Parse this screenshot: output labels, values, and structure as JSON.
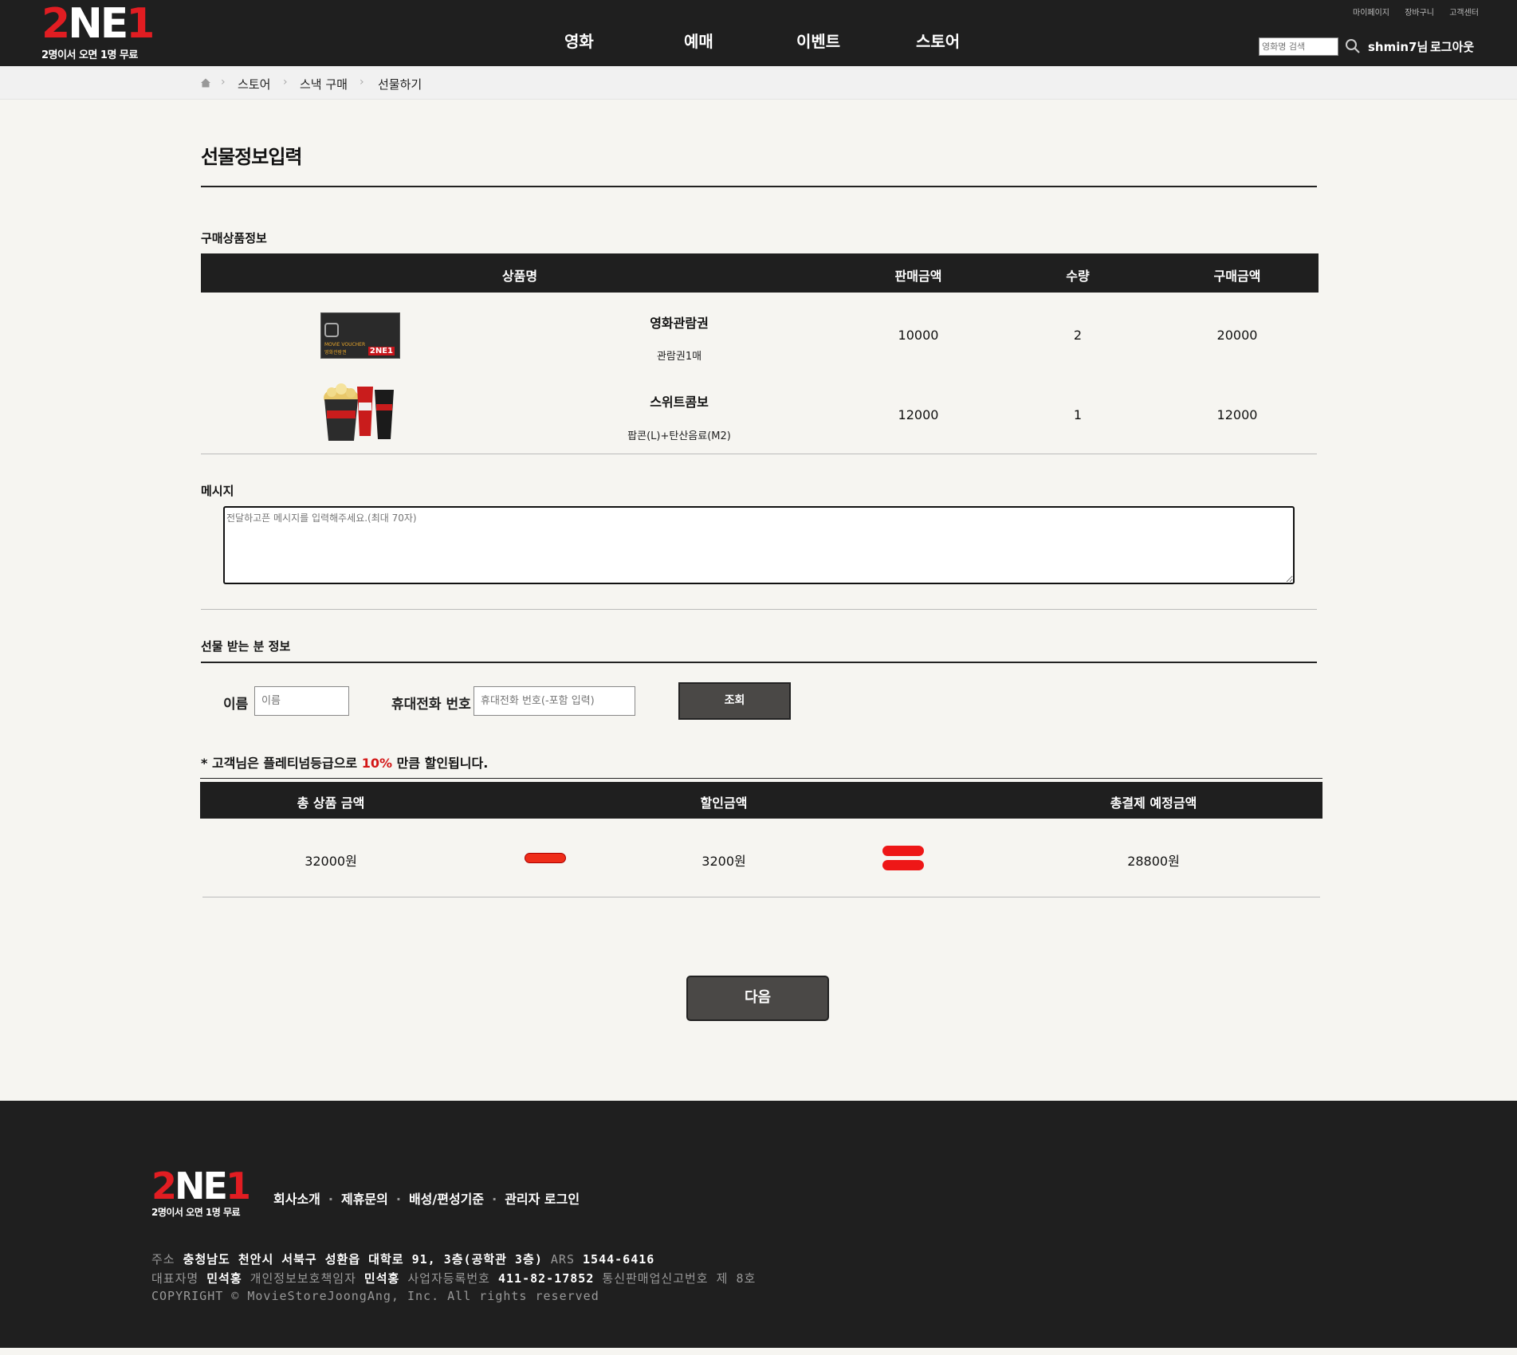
{
  "header": {
    "logo_mark": "2NE1",
    "logo_tagline": "2명이서 오면 1명 무료",
    "nav": [
      "영화",
      "예매",
      "이벤트",
      "스토어"
    ],
    "util_links": [
      "마이페이지",
      "장바구니",
      "고객센터"
    ],
    "search_placeholder": "영화명 검색",
    "user_name": "shmin7님",
    "logout": "로그아웃"
  },
  "breadcrumb": [
    "스토어",
    "스낵 구매",
    "선물하기"
  ],
  "page_title": "선물정보입력",
  "purchase": {
    "section_label": "구매상품정보",
    "columns": [
      "상품명",
      "판매금액",
      "수량",
      "구매금액"
    ],
    "items": [
      {
        "name": "영화관람권",
        "desc": "관람권1매",
        "price": "10000",
        "qty": "2",
        "total": "20000",
        "thumb_text": "MOVIE VOUCHER",
        "thumb_sub": "영화관람권",
        "thumb_brand": "2NE1"
      },
      {
        "name": "스위트콤보",
        "desc": "팝콘(L)+탄산음료(M2)",
        "price": "12000",
        "qty": "1",
        "total": "12000"
      }
    ]
  },
  "message": {
    "label": "메시지",
    "placeholder": "전달하고픈 메시지를 입력해주세요.(최대 70자)"
  },
  "recipient": {
    "label": "선물 받는 분 정보",
    "name_label": "이름",
    "name_placeholder": "이름",
    "phone_label": "휴대전화 번호",
    "phone_placeholder": "휴대전화 번호(-포함 입력)",
    "lookup_button": "조회"
  },
  "discount": {
    "note_prefix": "* 고객님은 플레티넘등급으로 ",
    "rate": "10%",
    "note_suffix": " 만큼 할인됩니다."
  },
  "summary": {
    "columns": [
      "총 상품 금액",
      "할인금액",
      "총결제 예정금액"
    ],
    "total": "32000원",
    "discount": "3200원",
    "final": "28800원"
  },
  "next_button": "다음",
  "footer": {
    "logo_mark": "2NE1",
    "logo_tagline": "2명이서 오면 1명 무료",
    "links": [
      "회사소개",
      "제휴문의",
      "배성/편성기준",
      "관리자 로그인"
    ],
    "address_label": "주소",
    "address": "충청남도 천안시 서북구 성환읍 대학로 91, 3층(공학관 3층)",
    "ars_label": "ARS",
    "ars": "1544-6416",
    "ceo_label": "대표자명",
    "ceo": "민석홍",
    "privacy_label": "개인정보보호책임자",
    "privacy": "민석홍",
    "biz_label": "사업자등록번호",
    "biz": "411-82-17852",
    "ecommerce": "통신판매업신고번호 제 8호",
    "copyright": "COPYRIGHT © MovieStoreJoongAng, Inc. All rights reserved"
  },
  "colors": {
    "header_bg": "#1f1f1f",
    "accent_red": "#e11d22",
    "button_dark": "#4a4846",
    "page_bg": "#f6f5f1"
  }
}
